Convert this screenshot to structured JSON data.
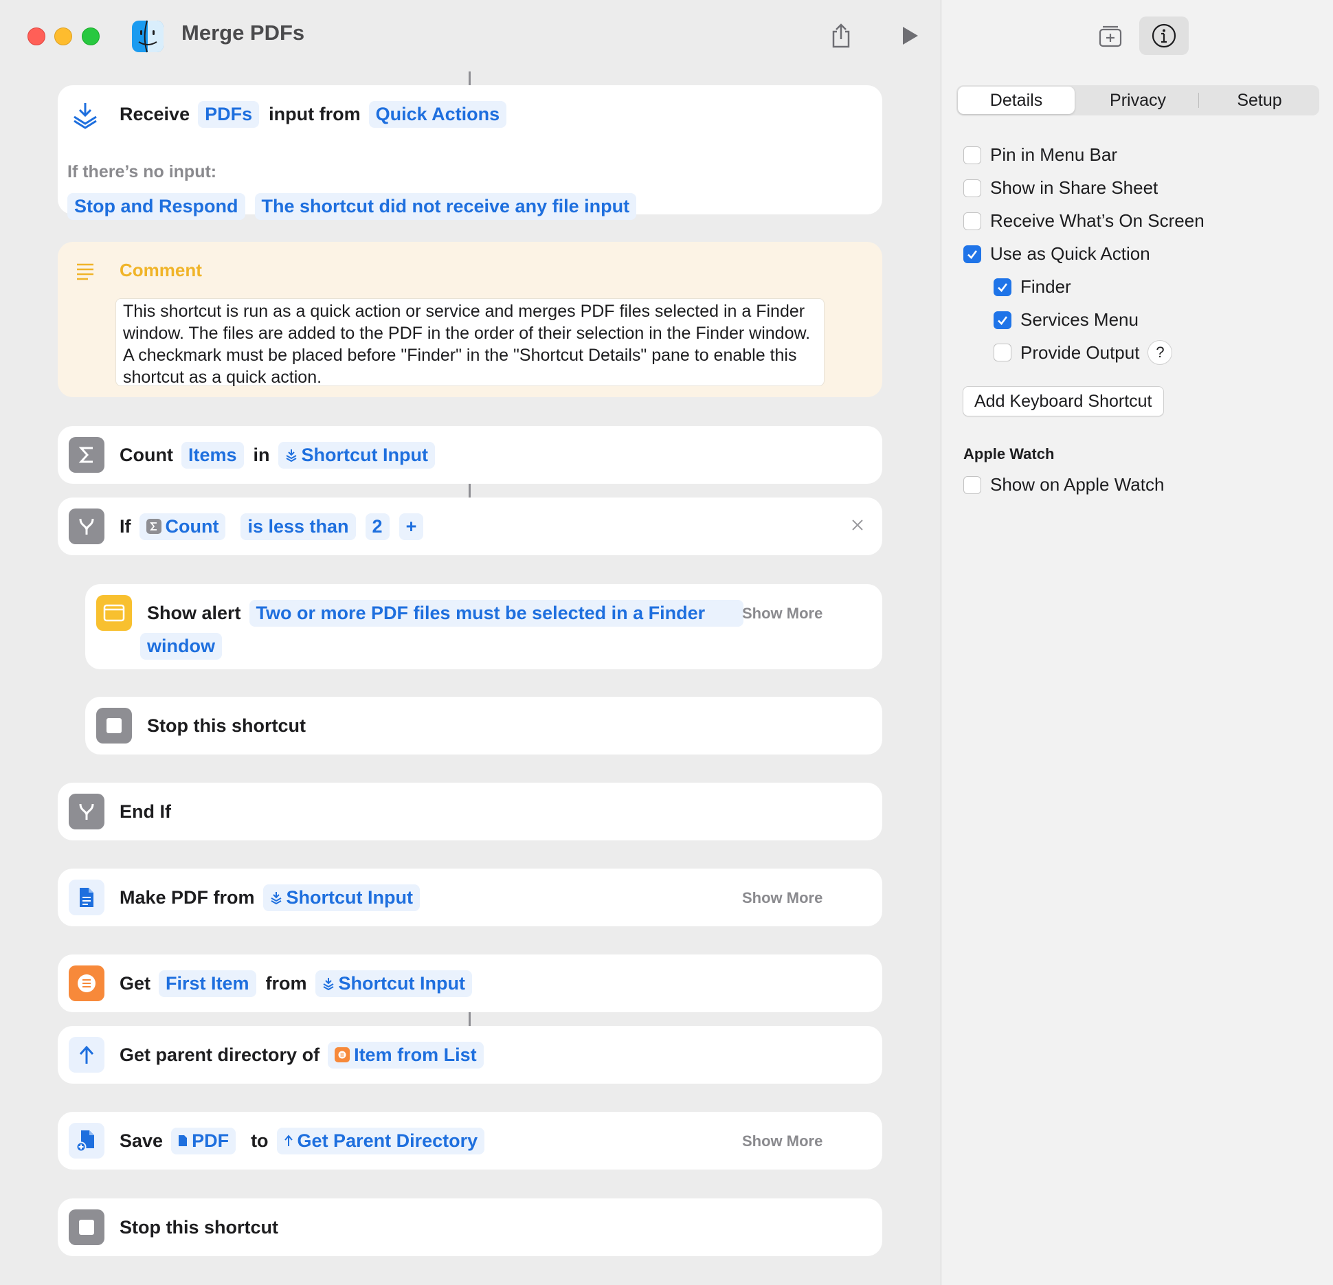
{
  "window": {
    "title": "Merge PDFs"
  },
  "actions": {
    "receive": {
      "kw1": "Receive",
      "tok1": "PDFs",
      "kw2": "input from",
      "tok2": "Quick Actions",
      "no_input_label": "If there’s no input:",
      "tok3": "Stop and Respond",
      "tok4": "The shortcut did not receive any file input"
    },
    "comment": {
      "title": "Comment",
      "text": "This shortcut is run as a quick action or service and merges PDF files selected in a Finder window. The files are added to the PDF in the order of their selection in the Finder window. A checkmark must be placed before \"Finder\" in the \"Shortcut Details\" pane to enable this shortcut as a quick action."
    },
    "count": {
      "kw1": "Count",
      "tok1": "Items",
      "kw2": "in",
      "tok2": "Shortcut Input"
    },
    "if": {
      "kw1": "If",
      "tok1": "Count",
      "tok2": "is less than",
      "tok3": "2",
      "add": "+"
    },
    "alert": {
      "kw1": "Show alert",
      "tok1_line1": "Two or more PDF files must be selected in a Finder",
      "tok1_line2": "window",
      "show_more": "Show More"
    },
    "stop1": {
      "kw1": "Stop this shortcut"
    },
    "endif": {
      "kw1": "End If"
    },
    "makepdf": {
      "kw1": "Make PDF from",
      "tok1": "Shortcut Input",
      "show_more": "Show More"
    },
    "getitem": {
      "kw1": "Get",
      "tok1": "First Item",
      "kw2": "from",
      "tok2": "Shortcut Input"
    },
    "parent": {
      "kw1": "Get parent directory of",
      "tok1": "Item from List"
    },
    "save": {
      "kw1": "Save",
      "tok1": "PDF",
      "kw2": "to",
      "tok2": "Get Parent Directory",
      "show_more": "Show More"
    },
    "stop2": {
      "kw1": "Stop this shortcut"
    }
  },
  "sidebar": {
    "tabs": [
      "Details",
      "Privacy",
      "Setup"
    ],
    "selected_tab": "Details",
    "options": [
      {
        "label": "Pin in Menu Bar",
        "checked": false
      },
      {
        "label": "Show in Share Sheet",
        "checked": false
      },
      {
        "label": "Receive What’s On Screen",
        "checked": false
      },
      {
        "label": "Use as Quick Action",
        "checked": true
      },
      {
        "label": "Finder",
        "checked": true
      },
      {
        "label": "Services Menu",
        "checked": true
      },
      {
        "label": "Provide Output",
        "checked": false
      }
    ],
    "help_label": "?",
    "keyboard_button": "Add Keyboard Shortcut",
    "apple_watch_header": "Apple Watch",
    "apple_watch_option": {
      "label": "Show on Apple Watch",
      "checked": false
    }
  },
  "colors": {
    "accent": "#1e6fde",
    "comment_bg": "#fcf3e5",
    "comment_title": "#f0b429"
  }
}
